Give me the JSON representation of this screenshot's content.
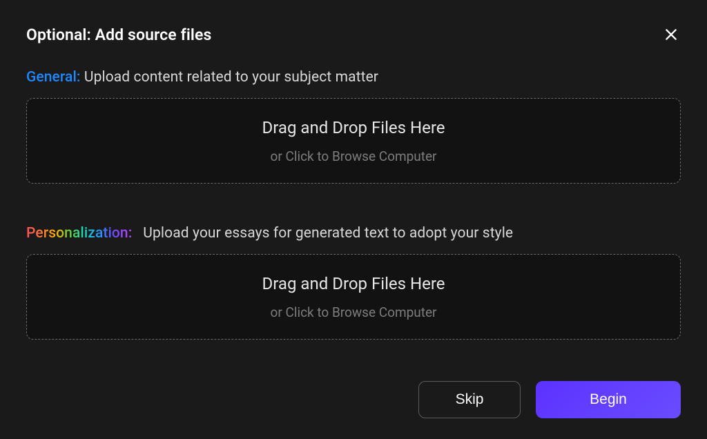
{
  "header": {
    "title": "Optional: Add source files"
  },
  "sections": {
    "general": {
      "label": "General:",
      "desc": "Upload content related to your subject matter",
      "drop_main": "Drag and Drop Files Here",
      "drop_sub": "or Click to Browse Computer"
    },
    "personalization": {
      "label": "Personalization:",
      "desc": "Upload your essays for generated text to adopt your style",
      "drop_main": "Drag and Drop Files Here",
      "drop_sub": "or Click to Browse Computer"
    }
  },
  "footer": {
    "skip_label": "Skip",
    "begin_label": "Begin"
  }
}
